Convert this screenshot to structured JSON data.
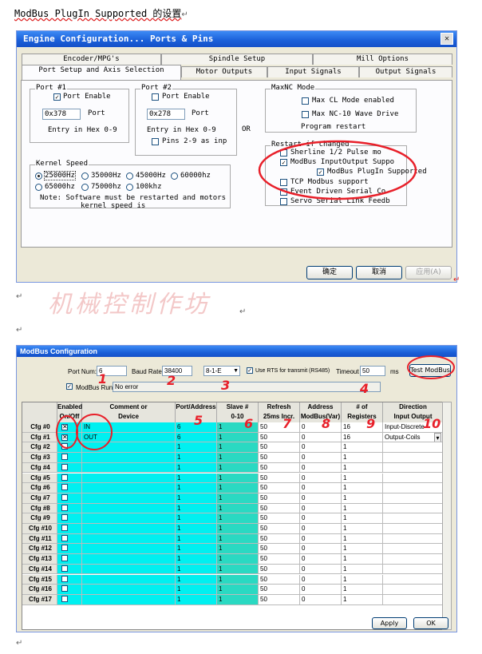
{
  "doc": {
    "title": "ModBus PlugIn Supported 的设置",
    "para_mark": "↵"
  },
  "engine_window": {
    "title": "Engine Configuration... Ports & Pins",
    "close": "✕",
    "tabs_back": [
      "Encoder/MPG's",
      "Spindle Setup",
      "Mill Options"
    ],
    "tabs_front": [
      "Port Setup and Axis Selection",
      "Motor Outputs",
      "Input Signals",
      "Output Signals"
    ],
    "port1": {
      "title": "Port #1",
      "enable_label": "Port Enable",
      "enabled": true,
      "address": "0x378",
      "port_label": "Port",
      "hint": "Entry in Hex 0-9"
    },
    "port2": {
      "title": "Port #2",
      "enable_label": "Port Enable",
      "enabled": false,
      "address": "0x278",
      "port_label": "Port",
      "hint": "Entry in Hex 0-9",
      "pins_label": "Pins 2-9 as inp"
    },
    "or_label": "OR",
    "maxnc": {
      "title": "MaxNC Mode",
      "cl_label": "Max CL Mode enabled",
      "wave_label": "Max NC-10 Wave Drive",
      "restart": "Program restart"
    },
    "restart_group": {
      "title": "Restart if changed",
      "items": [
        {
          "label": "Sherline 1/2 Pulse mo",
          "checked": false
        },
        {
          "label": "ModBus InputOutput Suppo",
          "checked": true
        },
        {
          "label": "ModBus PlugIn Supported",
          "checked": true
        },
        {
          "label": "TCP Modbus support",
          "checked": false
        },
        {
          "label": "Event Driven Serial Co",
          "checked": false
        },
        {
          "label": "Servo Serial Link Feedb",
          "checked": false
        }
      ]
    },
    "kernel": {
      "title": "Kernel Speed",
      "options": [
        "25000Hz",
        "35000Hz",
        "45000Hz",
        "60000hz",
        "65000hz",
        "75000hz",
        "100khz"
      ],
      "selected": "25000Hz",
      "note1": "Note: Software must be restarted and motors",
      "note2": "kernel speed is"
    },
    "buttons": {
      "ok": "确定",
      "cancel": "取消",
      "apply": "应用(A)"
    }
  },
  "watermark": "机械控制作坊",
  "modbus_window": {
    "title": "ModBus Configuration",
    "port_num_label": "Port Num:",
    "port_num": "6",
    "baud_label": "Baud Rate:",
    "baud": "38400",
    "format": "8-1-E",
    "rts_label": "Use RTS for transmit (RS485)",
    "timeout_label": "Timeout",
    "timeout": "50",
    "ms_label": "ms",
    "test_button": "Test ModBus",
    "run_label": "ModBus Run",
    "status": "No error",
    "headers_top": [
      "Enabled",
      "Comment or",
      "Port/Address",
      "Slave #",
      "Refresh",
      "Address",
      "# of",
      "Direction"
    ],
    "headers_bottom": [
      "On/Off",
      "Device",
      "",
      "0-10",
      "25ms Incr.",
      "ModBus(Var)",
      "Registers",
      "Input Output"
    ],
    "rows": [
      {
        "cfg": "Cfg #0",
        "on": true,
        "device": "IN",
        "port": "6",
        "slave": "1",
        "refresh": "50",
        "address": "0",
        "regs": "16",
        "dir": "Input-Discrete"
      },
      {
        "cfg": "Cfg #1",
        "on": true,
        "device": "OUT",
        "port": "6",
        "slave": "1",
        "refresh": "50",
        "address": "0",
        "regs": "16",
        "dir": "Output-Coils"
      },
      {
        "cfg": "Cfg #2",
        "on": false,
        "device": "",
        "port": "1",
        "slave": "1",
        "refresh": "50",
        "address": "0",
        "regs": "1",
        "dir": ""
      },
      {
        "cfg": "Cfg #3",
        "on": false,
        "device": "",
        "port": "1",
        "slave": "1",
        "refresh": "50",
        "address": "0",
        "regs": "1",
        "dir": ""
      },
      {
        "cfg": "Cfg #4",
        "on": false,
        "device": "",
        "port": "1",
        "slave": "1",
        "refresh": "50",
        "address": "0",
        "regs": "1",
        "dir": ""
      },
      {
        "cfg": "Cfg #5",
        "on": false,
        "device": "",
        "port": "1",
        "slave": "1",
        "refresh": "50",
        "address": "0",
        "regs": "1",
        "dir": ""
      },
      {
        "cfg": "Cfg #6",
        "on": false,
        "device": "",
        "port": "1",
        "slave": "1",
        "refresh": "50",
        "address": "0",
        "regs": "1",
        "dir": ""
      },
      {
        "cfg": "Cfg #7",
        "on": false,
        "device": "",
        "port": "1",
        "slave": "1",
        "refresh": "50",
        "address": "0",
        "regs": "1",
        "dir": ""
      },
      {
        "cfg": "Cfg #8",
        "on": false,
        "device": "",
        "port": "1",
        "slave": "1",
        "refresh": "50",
        "address": "0",
        "regs": "1",
        "dir": ""
      },
      {
        "cfg": "Cfg #9",
        "on": false,
        "device": "",
        "port": "1",
        "slave": "1",
        "refresh": "50",
        "address": "0",
        "regs": "1",
        "dir": ""
      },
      {
        "cfg": "Cfg #10",
        "on": false,
        "device": "",
        "port": "1",
        "slave": "1",
        "refresh": "50",
        "address": "0",
        "regs": "1",
        "dir": ""
      },
      {
        "cfg": "Cfg #11",
        "on": false,
        "device": "",
        "port": "1",
        "slave": "1",
        "refresh": "50",
        "address": "0",
        "regs": "1",
        "dir": ""
      },
      {
        "cfg": "Cfg #12",
        "on": false,
        "device": "",
        "port": "1",
        "slave": "1",
        "refresh": "50",
        "address": "0",
        "regs": "1",
        "dir": ""
      },
      {
        "cfg": "Cfg #13",
        "on": false,
        "device": "",
        "port": "1",
        "slave": "1",
        "refresh": "50",
        "address": "0",
        "regs": "1",
        "dir": ""
      },
      {
        "cfg": "Cfg #14",
        "on": false,
        "device": "",
        "port": "1",
        "slave": "1",
        "refresh": "50",
        "address": "0",
        "regs": "1",
        "dir": ""
      },
      {
        "cfg": "Cfg #15",
        "on": false,
        "device": "",
        "port": "1",
        "slave": "1",
        "refresh": "50",
        "address": "0",
        "regs": "1",
        "dir": ""
      },
      {
        "cfg": "Cfg #16",
        "on": false,
        "device": "",
        "port": "1",
        "slave": "1",
        "refresh": "50",
        "address": "0",
        "regs": "1",
        "dir": ""
      },
      {
        "cfg": "Cfg #17",
        "on": false,
        "device": "",
        "port": "1",
        "slave": "1",
        "refresh": "50",
        "address": "0",
        "regs": "1",
        "dir": ""
      }
    ],
    "buttons": {
      "apply": "Apply",
      "ok": "OK"
    },
    "annotations": [
      "1",
      "2",
      "3",
      "4",
      "5",
      "6",
      "7",
      "8",
      "9",
      "10"
    ]
  }
}
